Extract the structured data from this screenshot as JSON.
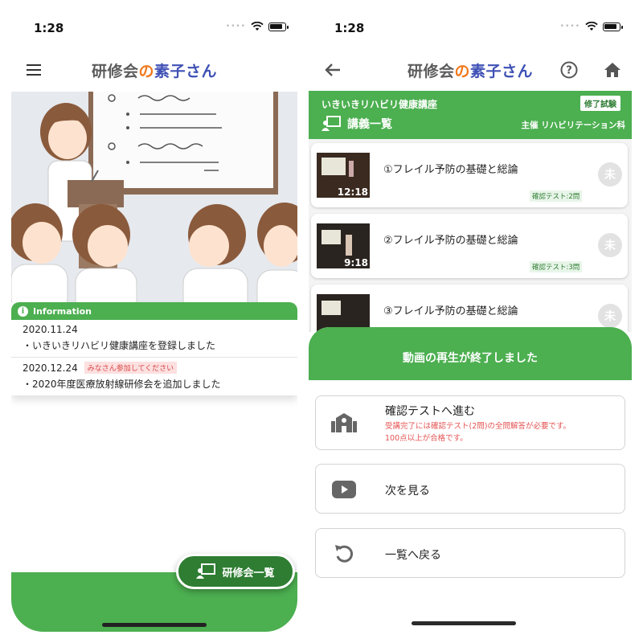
{
  "left": {
    "status_time": "1:28",
    "brand": {
      "part1": "研修会",
      "part2": "の",
      "part3": "素子さん"
    },
    "info": {
      "title": "Information",
      "news": [
        {
          "date": "2020.11.24",
          "tag": "",
          "body": "・いきいきリハビリ健康講座を登録しました"
        },
        {
          "date": "2020.12.24",
          "tag": "みなさん参加してください",
          "body": "・2020年度医療放射線研修会を追加しました"
        }
      ]
    },
    "fab_label": "研修会一覧"
  },
  "right": {
    "status_time": "1:28",
    "brand": {
      "part1": "研修会",
      "part2": "の",
      "part3": "素子さん"
    },
    "course": {
      "title": "いきいきリハビリ健康講座",
      "exam_badge": "修了試験",
      "list_title": "講義一覧",
      "host": "主催 リハビリテーション科"
    },
    "lectures": [
      {
        "title": "①フレイル予防の基礎と総論",
        "duration": "12:18",
        "test": "確認テスト:2問",
        "status": "未"
      },
      {
        "title": "②フレイル予防の基礎と総論",
        "duration": "9:18",
        "test": "確認テスト:3問",
        "status": "未"
      },
      {
        "title": "③フレイル予防の基礎と総論",
        "duration": "",
        "test": "",
        "status": "未"
      }
    ],
    "sheet": {
      "title": "動画の再生が終了しました",
      "quiz_label": "確認テストへ進む",
      "quiz_note1": "受講完了には確認テスト(2問)の全問解答が必要です。",
      "quiz_note2": "100点以上が合格です。",
      "next_label": "次を見る",
      "back_label": "一覧へ戻る"
    }
  },
  "colors": {
    "green": "#4caf50",
    "dark_green": "#2e7d32",
    "orange": "#f07a1e",
    "indigo": "#3f51b5",
    "alert_red": "#e55353"
  }
}
